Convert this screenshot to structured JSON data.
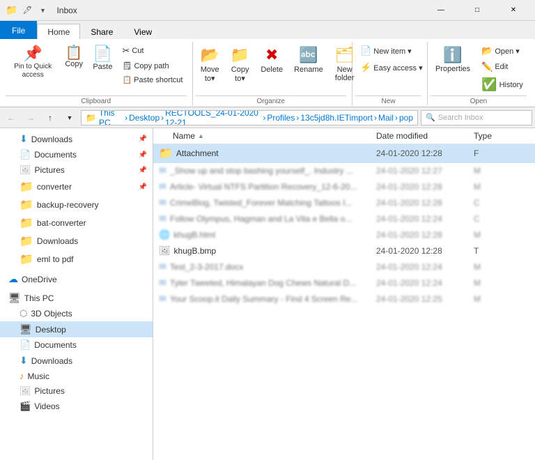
{
  "titlebar": {
    "title": "Inbox",
    "quick_access_icon": "📁",
    "minimize_label": "—",
    "maximize_label": "□",
    "close_label": "✕"
  },
  "ribbon": {
    "tabs": [
      "File",
      "Home",
      "Share",
      "View"
    ],
    "active_tab": "Home",
    "groups": {
      "clipboard": {
        "label": "Clipboard",
        "pin_label": "Pin to Quick\naccess",
        "copy_label": "Copy",
        "paste_label": "Paste",
        "cut_label": "Cut",
        "cut_path_label": "Copy path",
        "paste_shortcut_label": "Paste shortcut"
      },
      "organize": {
        "label": "Organize",
        "move_to_label": "Move\nto▾",
        "copy_to_label": "Copy\nto▾",
        "delete_label": "Delete",
        "rename_label": "Rename",
        "new_folder_label": "New\nfolder"
      },
      "new": {
        "label": "New",
        "new_item_label": "New item ▾",
        "easy_access_label": "Easy access ▾"
      },
      "open_group": {
        "label": "Open",
        "properties_label": "Properties",
        "open_label": "Open ▾",
        "edit_label": "Edit",
        "history_label": "History"
      }
    }
  },
  "address_bar": {
    "path_parts": [
      "This PC",
      "Desktop",
      "RECTOOLS_24-01-2020 12-21",
      "Profiles",
      "13c5jd8h.IETimport",
      "Mail",
      "pop"
    ],
    "search_placeholder": "Search Inbox"
  },
  "sidebar": {
    "quick_access_items": [
      {
        "label": "Downloads",
        "icon": "downloads",
        "pinned": true
      },
      {
        "label": "Documents",
        "icon": "documents",
        "pinned": true
      },
      {
        "label": "Pictures",
        "icon": "pictures",
        "pinned": true
      },
      {
        "label": "converter",
        "icon": "folder",
        "pinned": true
      },
      {
        "label": "backup-recovery",
        "icon": "folder",
        "pinned": false
      },
      {
        "label": "bat-converter",
        "icon": "folder",
        "pinned": false
      },
      {
        "label": "Downloads",
        "icon": "folder",
        "pinned": false
      },
      {
        "label": "eml to pdf",
        "icon": "folder",
        "pinned": false
      }
    ],
    "onedrive_label": "OneDrive",
    "this_pc_label": "This PC",
    "this_pc_items": [
      {
        "label": "3D Objects",
        "icon": "3dobjects"
      },
      {
        "label": "Desktop",
        "icon": "desktop",
        "selected": true
      },
      {
        "label": "Documents",
        "icon": "documents"
      },
      {
        "label": "Downloads",
        "icon": "downloads"
      },
      {
        "label": "Music",
        "icon": "music"
      },
      {
        "label": "Pictures",
        "icon": "pictures"
      },
      {
        "label": "Videos",
        "icon": "videos"
      }
    ]
  },
  "file_list": {
    "columns": [
      "Name",
      "Date modified",
      "Type"
    ],
    "sort_column": "Name",
    "sort_dir": "asc",
    "rows": [
      {
        "name": "Attachment",
        "date": "24-01-2020 12:28",
        "type": "F",
        "icon": "folder",
        "selected": true
      },
      {
        "name": "_Show up and stop bashing yourself_. Industry ...",
        "date": "24-01-2020 12:27",
        "type": "M",
        "icon": "email",
        "blurred": true
      },
      {
        "name": "Article- Virtual NTFS Partition Recovery_12-6-20...",
        "date": "24-01-2020 12:28",
        "type": "M",
        "icon": "email",
        "blurred": true
      },
      {
        "name": "CrimeBlog, Twisted_Forever Matching Tattoos I...",
        "date": "24-01-2020 12:28",
        "type": "C",
        "icon": "email",
        "blurred": true
      },
      {
        "name": "Follow Olympus, Hagman and La Vita e Bella o...",
        "date": "24-01-2020 12:24",
        "type": "C",
        "icon": "email",
        "blurred": true
      },
      {
        "name": "khugB.html",
        "date": "24-01-2020 12:28",
        "type": "M",
        "icon": "chrome",
        "blurred": true
      },
      {
        "name": "khugB.bmp",
        "date": "24-01-2020 12:28",
        "type": "T",
        "icon": "bmp",
        "blurred": false
      },
      {
        "name": "Test_2-3-2017.docx",
        "date": "24-01-2020 12:24",
        "type": "M",
        "icon": "email",
        "blurred": true
      },
      {
        "name": "Tyler Tweeted, Himalayan Dog Chews Natural D...",
        "date": "24-01-2020 12:24",
        "type": "M",
        "icon": "email",
        "blurred": true
      },
      {
        "name": "Your Scoop.it Daily Summary - Find 4 Screen Re...",
        "date": "24-01-2020 12:25",
        "type": "M",
        "icon": "email",
        "blurred": true
      }
    ]
  }
}
